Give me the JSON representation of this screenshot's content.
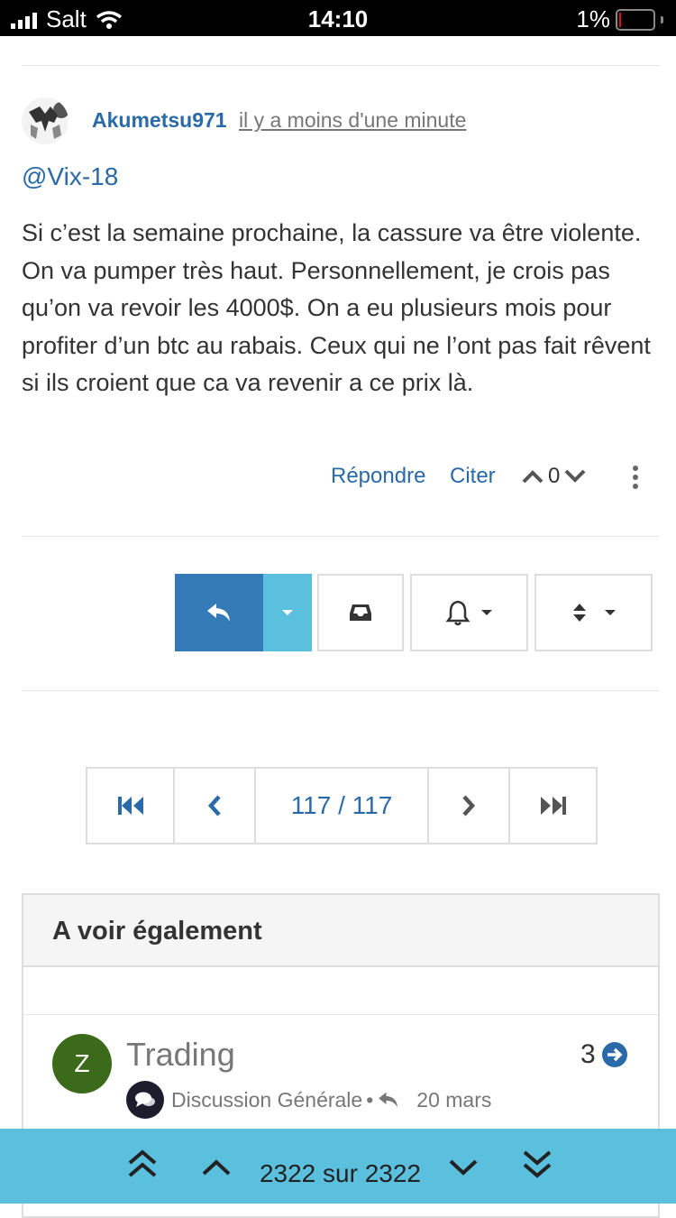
{
  "status_bar": {
    "carrier": "Salt",
    "time": "14:10",
    "battery": "1%"
  },
  "post": {
    "author": "Akumetsu971",
    "timeago": "il y a moins d'une minute",
    "mention": "@Vix-18",
    "body": "Si c’est la semaine prochaine, la cassure va être violente. On va pumper très haut. Personnellement, je crois pas qu’on va revoir les 4000$. On a eu plusieurs mois pour profiter d’un btc au rabais. Ceux qui ne l’ont pas fait rêvent si ils croient que ca va revenir a ce prix là.",
    "actions": {
      "reply": "Répondre",
      "quote": "Citer"
    },
    "votes": "0"
  },
  "pagination": {
    "label": "117 / 117"
  },
  "related": {
    "heading": "A voir également",
    "topic": {
      "avatar_letter": "Z",
      "title": "Trading",
      "count": "3",
      "category": "Discussion Générale",
      "separator": "•",
      "date": "20 mars"
    }
  },
  "bottom_nav": {
    "position": "2322 sur 2322"
  },
  "colors": {
    "accent": "#2a6aa8",
    "primary_button": "#337ab7",
    "info_button": "#5bc0de",
    "bottom_bar": "#5bc0de",
    "category_avatar": "#3b6b1a"
  }
}
